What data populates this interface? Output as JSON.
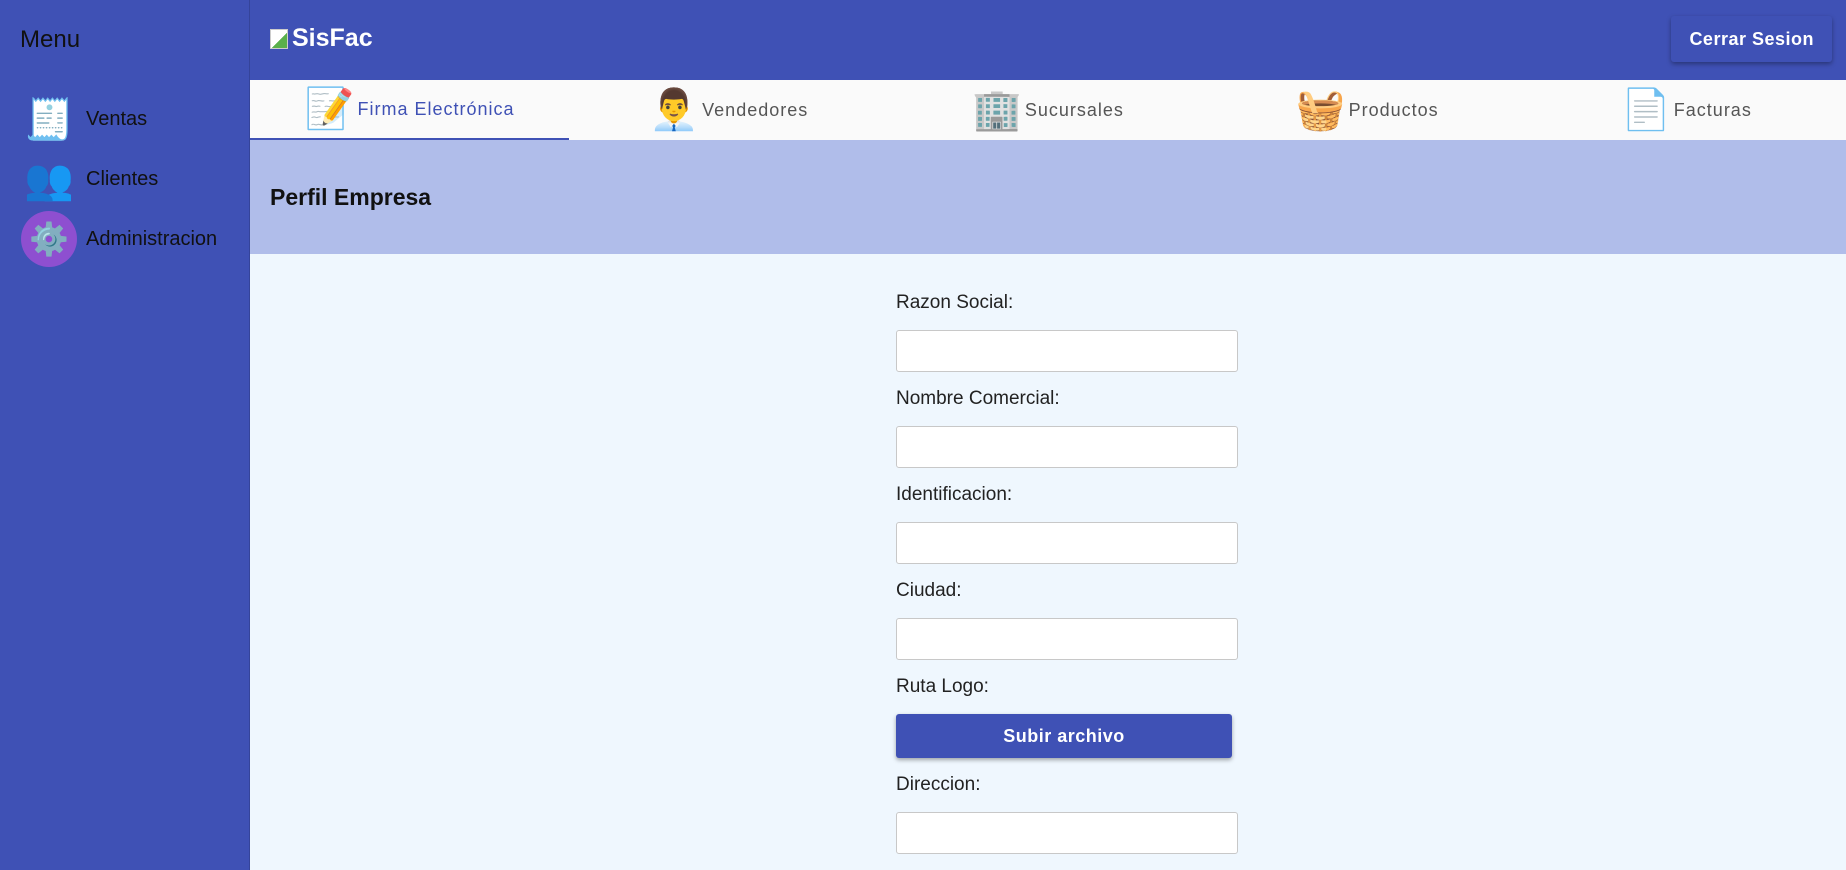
{
  "sidebar": {
    "title": "Menu",
    "items": [
      {
        "label": "Ventas",
        "icon": "cash-register-icon"
      },
      {
        "label": "Clientes",
        "icon": "users-icon"
      },
      {
        "label": "Administracion",
        "icon": "admin-gear-icon"
      }
    ]
  },
  "header": {
    "brand": "SisFac",
    "logout_label": "Cerrar Sesion"
  },
  "tabs": [
    {
      "label": "Firma Electrónica",
      "icon": "signed-document-icon",
      "active": true
    },
    {
      "label": "Vendedores",
      "icon": "salesman-icon"
    },
    {
      "label": "Sucursales",
      "icon": "buildings-icon"
    },
    {
      "label": "Productos",
      "icon": "grocery-basket-icon"
    },
    {
      "label": "Facturas",
      "icon": "invoice-icon"
    }
  ],
  "page": {
    "title": "Perfil Empresa"
  },
  "form": {
    "razon_social": {
      "label": "Razon Social:",
      "value": ""
    },
    "nombre_comercial": {
      "label": "Nombre Comercial:",
      "value": ""
    },
    "identificacion": {
      "label": "Identificacion:",
      "value": ""
    },
    "ciudad": {
      "label": "Ciudad:",
      "value": ""
    },
    "ruta_logo": {
      "label": "Ruta Logo:",
      "button": "Subir archivo"
    },
    "direccion": {
      "label": "Direccion:",
      "value": ""
    }
  },
  "colors": {
    "primary": "#3f51b5",
    "banner": "#b0bdea",
    "background": "#eff7fe"
  }
}
